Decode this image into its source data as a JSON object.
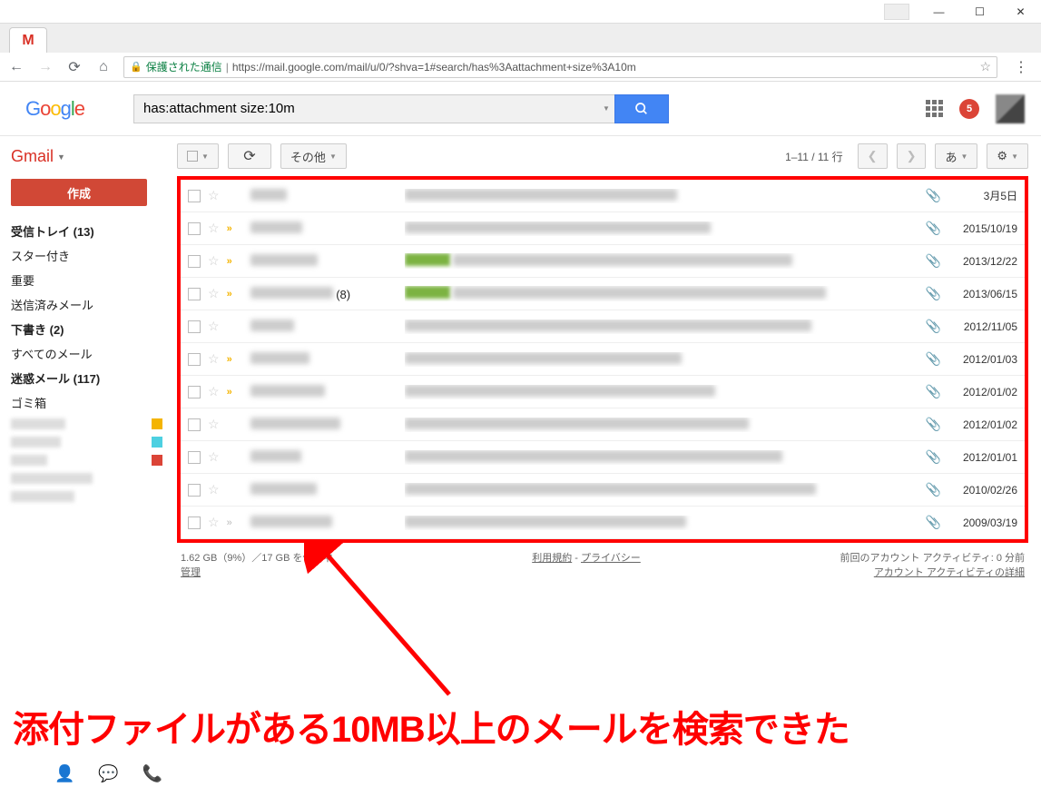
{
  "window": {
    "minimize": "—",
    "maximize": "☐",
    "close": "✕"
  },
  "browser": {
    "secure_label": "保護された通信",
    "url_prefix": "https://",
    "url": "mail.google.com/mail/u/0/?shva=1#search/has%3Aattachment+size%3A10m"
  },
  "header": {
    "logo_chars": [
      "G",
      "o",
      "o",
      "g",
      "l",
      "e"
    ],
    "search_value": "has:attachment size:10m",
    "notif_count": "5"
  },
  "sidebar": {
    "app_name": "Gmail",
    "compose": "作成",
    "items": [
      {
        "label": "受信トレイ (13)",
        "bold": true
      },
      {
        "label": "スター付き",
        "bold": false
      },
      {
        "label": "重要",
        "bold": false
      },
      {
        "label": "送信済みメール",
        "bold": false
      },
      {
        "label": "下書き (2)",
        "bold": true
      },
      {
        "label": "すべてのメール",
        "bold": false
      },
      {
        "label": "迷惑メール (117)",
        "bold": true
      },
      {
        "label": "ゴミ箱",
        "bold": false
      }
    ]
  },
  "toolbar": {
    "refresh": "↻",
    "more": "その他",
    "pager": "1–11 / 11 行",
    "lang": "あ"
  },
  "emails": [
    {
      "marker": "",
      "thread": "",
      "date": "3月5日"
    },
    {
      "marker": "yellow",
      "thread": "",
      "date": "2015/10/19"
    },
    {
      "marker": "yellow",
      "thread": "",
      "date": "2013/12/22"
    },
    {
      "marker": "yellow",
      "thread": "(8)",
      "date": "2013/06/15"
    },
    {
      "marker": "",
      "thread": "",
      "date": "2012/11/05"
    },
    {
      "marker": "yellow",
      "thread": "",
      "date": "2012/01/03"
    },
    {
      "marker": "yellow",
      "thread": "",
      "date": "2012/01/02"
    },
    {
      "marker": "",
      "thread": "",
      "date": "2012/01/02"
    },
    {
      "marker": "",
      "thread": "",
      "date": "2012/01/01"
    },
    {
      "marker": "",
      "thread": "",
      "date": "2010/02/26"
    },
    {
      "marker": "grey",
      "thread": "",
      "date": "2009/03/19"
    }
  ],
  "footer": {
    "storage": "1.62 GB（9%）／17 GB を使用中",
    "manage": "管理",
    "terms": "利用規約",
    "privacy": "プライバシー",
    "activity1": "前回のアカウント アクティビティ: 0 分前",
    "activity2": "アカウント アクティビティの詳細"
  },
  "annotation": {
    "text": "添付ファイルがある10MB以上のメールを検索できた"
  }
}
